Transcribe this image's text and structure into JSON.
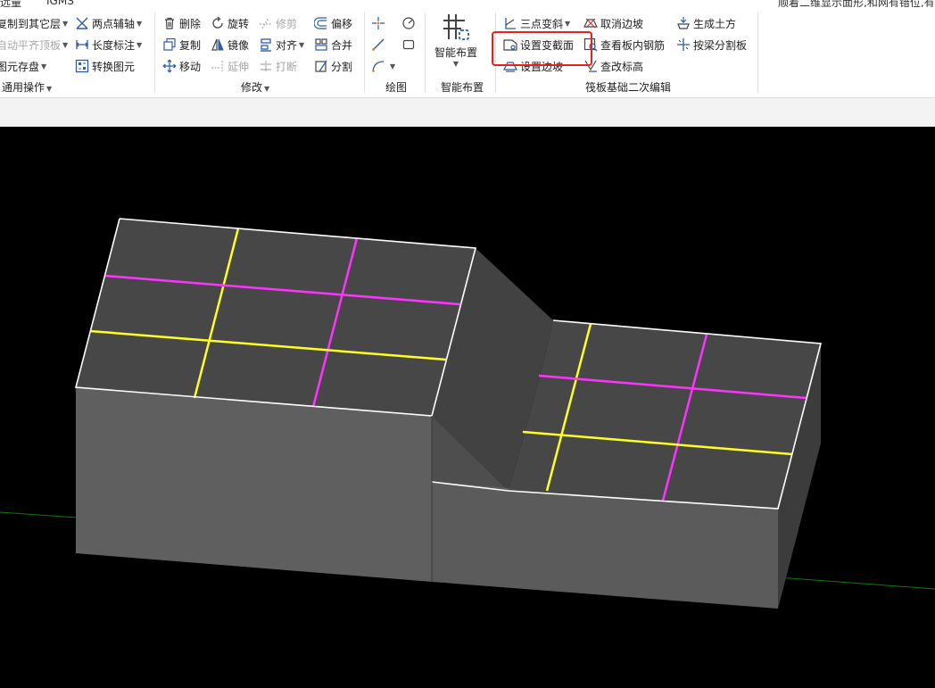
{
  "topbar": {
    "left_fragment": "远量",
    "left_fragment2": "IGMS",
    "right_fragment": "顺着二维显示面形,和网有错位,有"
  },
  "ribbon": {
    "general": {
      "group_label": "通用操作",
      "copy_to_layer": "复制到其它层",
      "auto_flat_top": "自动平齐顶板",
      "elem_save": "图元存盘",
      "two_point_axis": "两点辅轴",
      "length_mark": "长度标注",
      "convert_elem": "转换图元"
    },
    "modify": {
      "group_label": "修改",
      "delete": "删除",
      "rotate": "旋转",
      "trim": "修剪",
      "offset": "偏移",
      "copy": "复制",
      "mirror": "镜像",
      "align": "对齐",
      "merge": "合并",
      "move": "移动",
      "extend": "延伸",
      "break": "打断",
      "split": "分割"
    },
    "draw": {
      "group_label": "绘图"
    },
    "smart": {
      "group_label": "智能布置",
      "smart_layout": "智能布置"
    },
    "raft": {
      "group_label": "筏板基础二次编辑",
      "three_point_slope": "三点变斜",
      "set_variable_section": "设置变截面",
      "set_slope_edge": "设置边坡",
      "cancel_slope_edge": "取消边坡",
      "view_rebar": "查看板内钢筋",
      "edit_elevation": "查改标高",
      "gen_earthwork": "生成土方",
      "split_by_beam": "按梁分割板"
    }
  },
  "colors": {
    "highlight": "#e8201e",
    "grid_yellow": "#ffff22",
    "grid_magenta": "#ff33ff",
    "axis_green": "#0a7a0a"
  }
}
